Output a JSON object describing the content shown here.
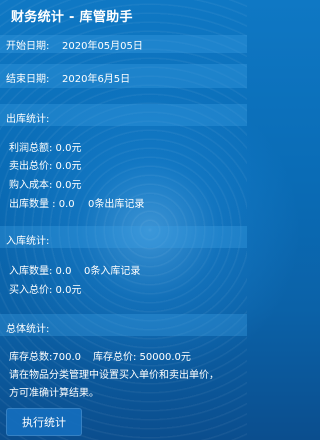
{
  "app": {
    "title": "财务统计 - 库管助手"
  },
  "dates": {
    "start_label": "开始日期:",
    "start_value": "2020年05月05日",
    "end_label": "结束日期:",
    "end_value": "2020年6月5日"
  },
  "outbound": {
    "header": "出库统计:",
    "profit": "利润总额: 0.0元",
    "sales_total": "卖出总价: 0.0元",
    "purchase_cost": "购入成本: 0.0元",
    "qty": "出库数量 : 0.0",
    "records": "0条出库记录"
  },
  "inbound": {
    "header": "入库统计:",
    "qty": "入库数量: 0.0",
    "records": "0条入库记录",
    "buy_total": "买入总价: 0.0元"
  },
  "overall": {
    "header": "总体统计:",
    "stock_qty": "库存总数:700.0",
    "stock_value": "库存总价: 50000.0元",
    "hint_line1": "请在物品分类管理中设置买入单价和卖出单价，",
    "hint_line2": "方可准确计算结果。"
  },
  "actions": {
    "run_label": "执行统计"
  }
}
